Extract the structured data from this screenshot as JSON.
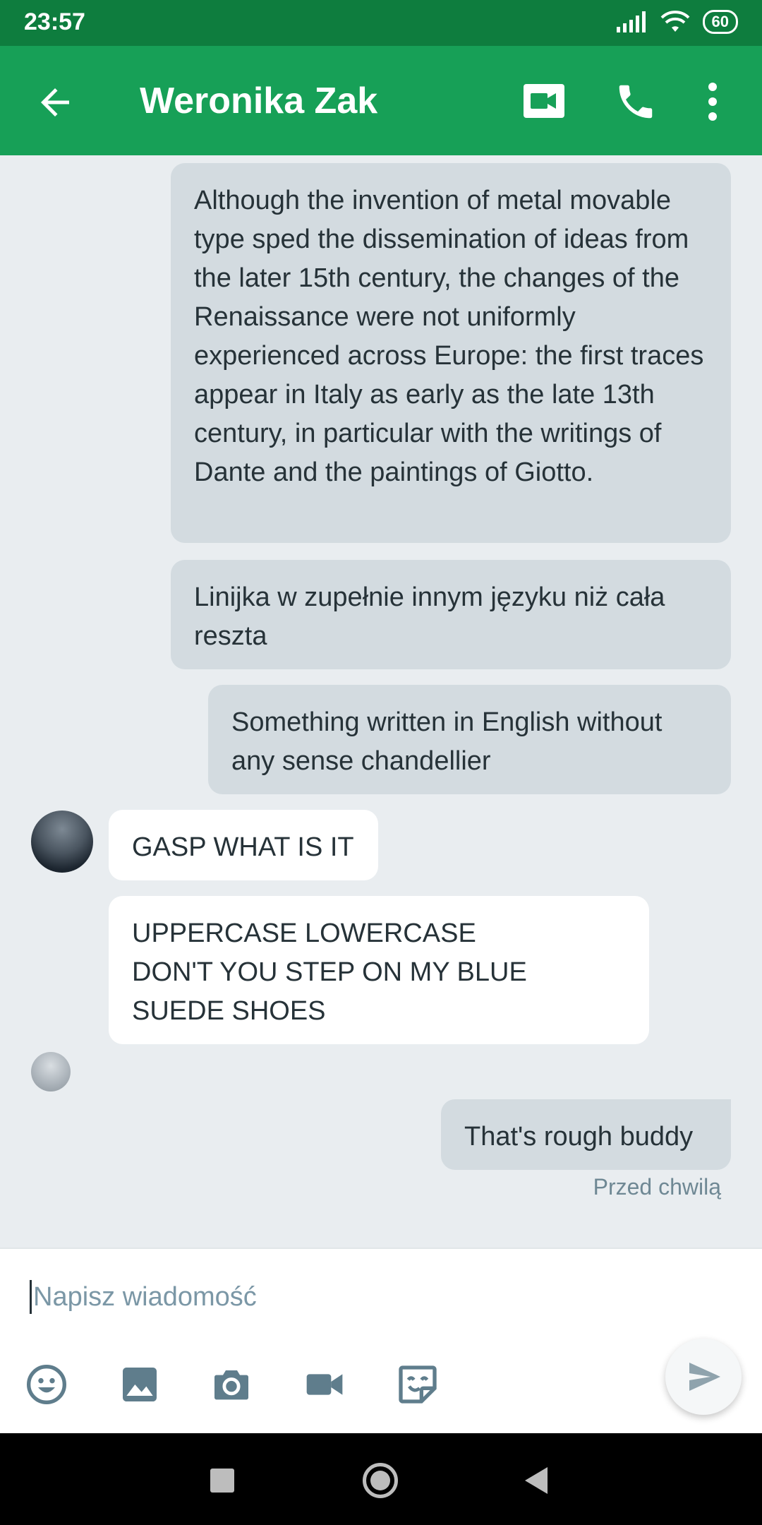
{
  "status_bar": {
    "time": "23:57",
    "battery": "60"
  },
  "header": {
    "contact_name": "Weronika Zak"
  },
  "messages": [
    {
      "direction": "outgoing",
      "text": "Although the invention of metal movable type sped the dissemination of ideas from the later 15th century, the changes of the Renaissance were not uniformly experienced across Europe: the first traces appear in Italy as early as the late 13th century, in particular with the writings of Dante and the paintings of Giotto."
    },
    {
      "direction": "outgoing",
      "text": "Linijka w zupełnie innym języku niż cała reszta"
    },
    {
      "direction": "outgoing",
      "text": "Something written in English without any sense chandellier"
    },
    {
      "direction": "incoming",
      "text": "GASP WHAT IS IT"
    },
    {
      "direction": "incoming",
      "text": "UPPERCASE LOWERCASE\nDON'T YOU STEP ON MY BLUE SUEDE SHOES"
    },
    {
      "direction": "outgoing",
      "text": "That's rough buddy"
    }
  ],
  "last_message_time": "Przed chwilą",
  "composer": {
    "placeholder": "Napisz wiadomość"
  },
  "icons": {
    "back": "arrow-back-icon",
    "video": "video-call-icon",
    "call": "phone-icon",
    "more": "more-vertical-icon",
    "emoji": "emoji-icon",
    "image": "image-icon",
    "camera": "camera-icon",
    "video_attach": "videocam-icon",
    "sticker": "sticker-icon",
    "send": "send-icon"
  },
  "colors": {
    "status_bar": "#0e7d3e",
    "app_bar": "#17a057",
    "outgoing_bubble": "#d3dbe0",
    "incoming_bubble": "#ffffff",
    "background": "#e9edf0",
    "icon": "#5f7d8c"
  }
}
